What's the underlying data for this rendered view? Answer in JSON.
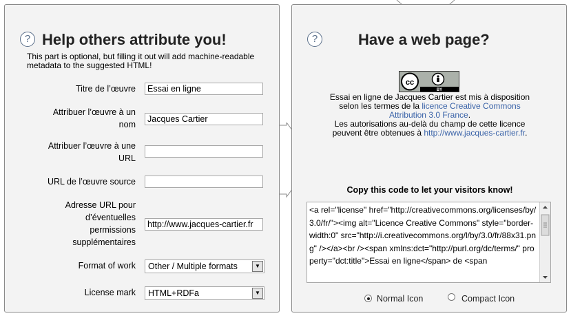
{
  "left": {
    "title": "Help others attribute you!",
    "intro": "This part is optional, but filling it out will add machine-readable metadata to the suggested HTML!",
    "fields": [
      {
        "label": "Titre de l’œuvre",
        "value": "Essai en ligne"
      },
      {
        "label": "Attribuer l’œuvre à un nom",
        "value": "Jacques Cartier"
      },
      {
        "label": "Attribuer l’œuvre à une URL",
        "value": ""
      },
      {
        "label": "URL de l’œuvre source",
        "value": ""
      },
      {
        "label": "Adresse URL pour d’éventuelles permissions supplémentaires",
        "value": "http://www.jacques-cartier.fr"
      }
    ],
    "format_label": "Format of work",
    "format_value": "Other / Multiple formats",
    "license_mark_label": "License mark",
    "license_mark_value": "HTML+RDFa"
  },
  "right": {
    "title": "Have a web page?",
    "badge_text": "BY",
    "notice_part1": "Essai en ligne de Jacques Cartier est mis à disposition selon les termes de la",
    "notice_link1": "licence Creative Commons Attribution 3.0 France",
    "notice_part2": "Les autorisations au-delà du champ de cette licence peuvent être obtenues à",
    "notice_link2": "http://www.jacques-cartier.fr",
    "copy_heading": "Copy this code to let your visitors know!",
    "code": "<a rel=\"license\" href=\"http://creativecommons.org/licenses/by/3.0/fr/\"><img alt=\"Licence Creative Commons\" style=\"border-width:0\" src=\"http://i.creativecommons.org/l/by/3.0/fr/88x31.png\" /></a><br /><span xmlns:dct=\"http://purl.org/dc/terms/\" property=\"dct:title\">Essai en ligne</span> de <span",
    "radio_normal": "Normal Icon",
    "radio_compact": "Compact Icon"
  },
  "colors": {
    "panel_bg": "#f3f3f3",
    "link": "#3a63a8",
    "help_icon": "#5a6f8a"
  }
}
